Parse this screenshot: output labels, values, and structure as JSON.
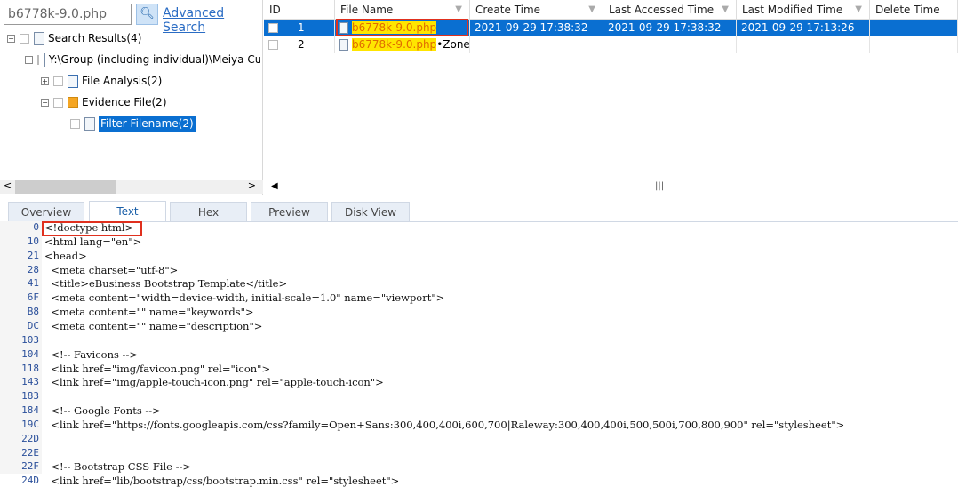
{
  "search": {
    "value": "b6778k-9.0.php",
    "button_icon": "search-icon",
    "advanced_label": "Advanced Search"
  },
  "tree": [
    {
      "label": "Search Results(4)",
      "expander": "−"
    },
    {
      "label": "Y:\\Group (including individual)\\Meiya Cup",
      "expander": "−"
    },
    {
      "label": "File Analysis(2)",
      "expander": "+"
    },
    {
      "label": "Evidence File(2)",
      "expander": "−"
    },
    {
      "label": "Filter Filename(2)",
      "expander": ""
    }
  ],
  "grid": {
    "columns": [
      "ID",
      "File Name",
      "Create Time",
      "Last Accessed Time",
      "Last Modified Time",
      "Delete Time"
    ],
    "rows": [
      {
        "id": "1",
        "name": "b6778k-9.0.php",
        "suffix": "",
        "create": "2021-09-29 17:38:32",
        "accessed": "2021-09-29 17:38:32",
        "modified": "2021-09-29 17:13:26",
        "deleted": ""
      },
      {
        "id": "2",
        "name": "b6778k-9.0.php",
        "suffix": "•Zone....",
        "create": "",
        "accessed": "",
        "modified": "",
        "deleted": ""
      }
    ],
    "scroll_mark": "|||"
  },
  "tabs": [
    "Overview",
    "Text",
    "Hex",
    "Preview",
    "Disk View"
  ],
  "active_tab": "Text",
  "code": [
    {
      "off": "0",
      "text": "<!doctype html>"
    },
    {
      "off": "10",
      "text": "<html lang=\"en\">"
    },
    {
      "off": "21",
      "text": "<head>"
    },
    {
      "off": "28",
      "text": "  <meta charset=\"utf-8\">"
    },
    {
      "off": "41",
      "text": "  <title>eBusiness Bootstrap Template</title>"
    },
    {
      "off": "6F",
      "text": "  <meta content=\"width=device-width, initial-scale=1.0\" name=\"viewport\">"
    },
    {
      "off": "B8",
      "text": "  <meta content=\"\" name=\"keywords\">"
    },
    {
      "off": "DC",
      "text": "  <meta content=\"\" name=\"description\">"
    },
    {
      "off": "103",
      "text": ""
    },
    {
      "off": "104",
      "text": "  <!-- Favicons -->"
    },
    {
      "off": "118",
      "text": "  <link href=\"img/favicon.png\" rel=\"icon\">"
    },
    {
      "off": "143",
      "text": "  <link href=\"img/apple-touch-icon.png\" rel=\"apple-touch-icon\">"
    },
    {
      "off": "183",
      "text": ""
    },
    {
      "off": "184",
      "text": "  <!-- Google Fonts -->"
    },
    {
      "off": "19C",
      "text": "  <link href=\"https://fonts.googleapis.com/css?family=Open+Sans:300,400,400i,600,700|Raleway:300,400,400i,500,500i,700,800,900\" rel=\"stylesheet\">"
    },
    {
      "off": "22D",
      "text": ""
    },
    {
      "off": "22E",
      "text": ""
    },
    {
      "off": "22F",
      "text": "  <!-- Bootstrap CSS File -->"
    },
    {
      "off": "24D",
      "text": "  <link href=\"lib/bootstrap/css/bootstrap.min.css\" rel=\"stylesheet\">"
    }
  ]
}
